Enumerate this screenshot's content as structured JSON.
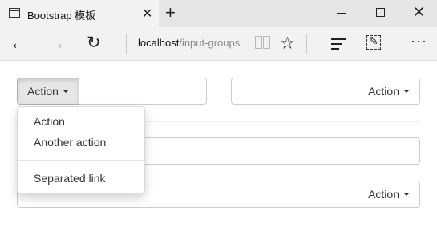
{
  "browser": {
    "tab_title": "Bootstrap 模板",
    "close_glyph": "✕",
    "new_tab_glyph": "+",
    "window_close_glyph": "✕",
    "back_glyph": "←",
    "forward_glyph": "→",
    "refresh_glyph": "↻",
    "favorite_glyph": "☆",
    "more_glyph": "···",
    "address_host": "localhost",
    "address_path": "/input-groups"
  },
  "page": {
    "group1": {
      "button_label": "Action",
      "input_value": ""
    },
    "group2": {
      "button_label": "Action",
      "input_value": ""
    },
    "group3": {
      "input_value": ""
    },
    "group4": {
      "button_label": "Action",
      "input_value": ""
    },
    "dropdown": {
      "items": [
        "Action",
        "Another action"
      ],
      "separated_items": [
        "Separated link"
      ]
    }
  },
  "colors": {
    "button_active_bg": "#e6e6e6",
    "border": "#cccccc",
    "chrome_bg": "#f2f2f2"
  }
}
